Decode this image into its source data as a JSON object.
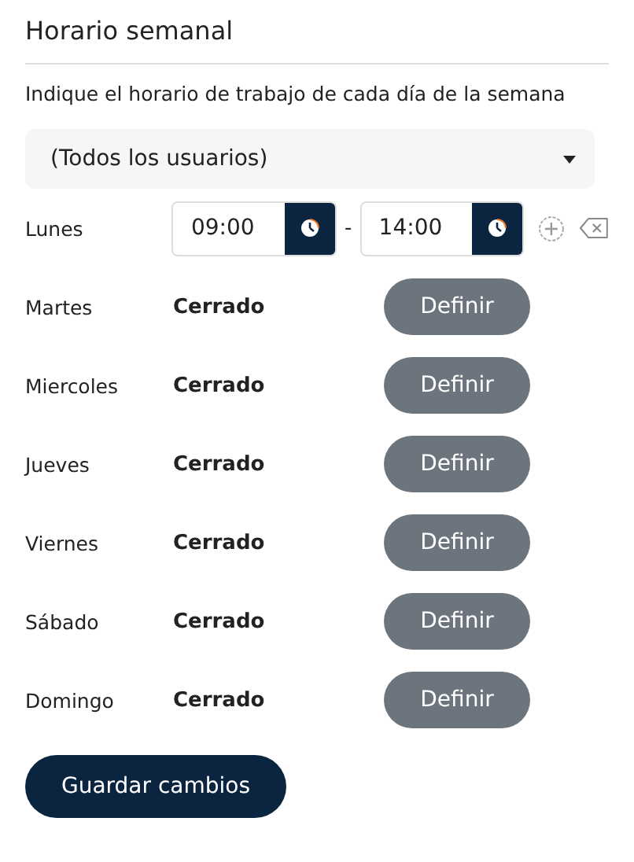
{
  "title": "Horario semanal",
  "description": "Indique el horario de trabajo de cada día de la semana",
  "user_select": {
    "value": "(Todos los usuarios)"
  },
  "days": [
    {
      "kind": "open",
      "name": "Lunes",
      "from": "09:00",
      "separator": "-",
      "to": "14:00"
    },
    {
      "kind": "closed",
      "name": "Martes",
      "status": "Cerrado",
      "button": "Definir"
    },
    {
      "kind": "closed",
      "name": "Miercoles",
      "status": "Cerrado",
      "button": "Definir"
    },
    {
      "kind": "closed",
      "name": "Jueves",
      "status": "Cerrado",
      "button": "Definir"
    },
    {
      "kind": "closed",
      "name": "Viernes",
      "status": "Cerrado",
      "button": "Definir"
    },
    {
      "kind": "closed",
      "name": "Sábado",
      "status": "Cerrado",
      "button": "Definir"
    },
    {
      "kind": "closed",
      "name": "Domingo",
      "status": "Cerrado",
      "button": "Definir"
    }
  ],
  "save_button": "Guardar cambios"
}
